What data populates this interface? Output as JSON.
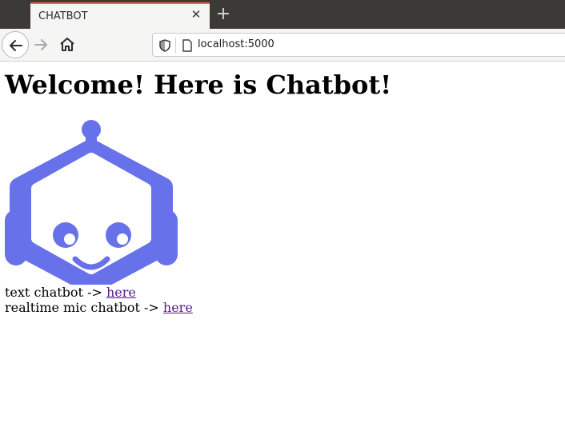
{
  "browser": {
    "tab_title": "CHATBOT",
    "tab_close_glyph": "✕",
    "new_tab_glyph": "+",
    "url": "localhost:5000",
    "accent_color": "#e96c35"
  },
  "page": {
    "heading": "Welcome! Here is Chatbot!",
    "robot_color": "#6772ea",
    "links": [
      {
        "prefix": "text chatbot -> ",
        "link_text": "here"
      },
      {
        "prefix": "realtime mic chatbot -> ",
        "link_text": "here"
      }
    ]
  }
}
